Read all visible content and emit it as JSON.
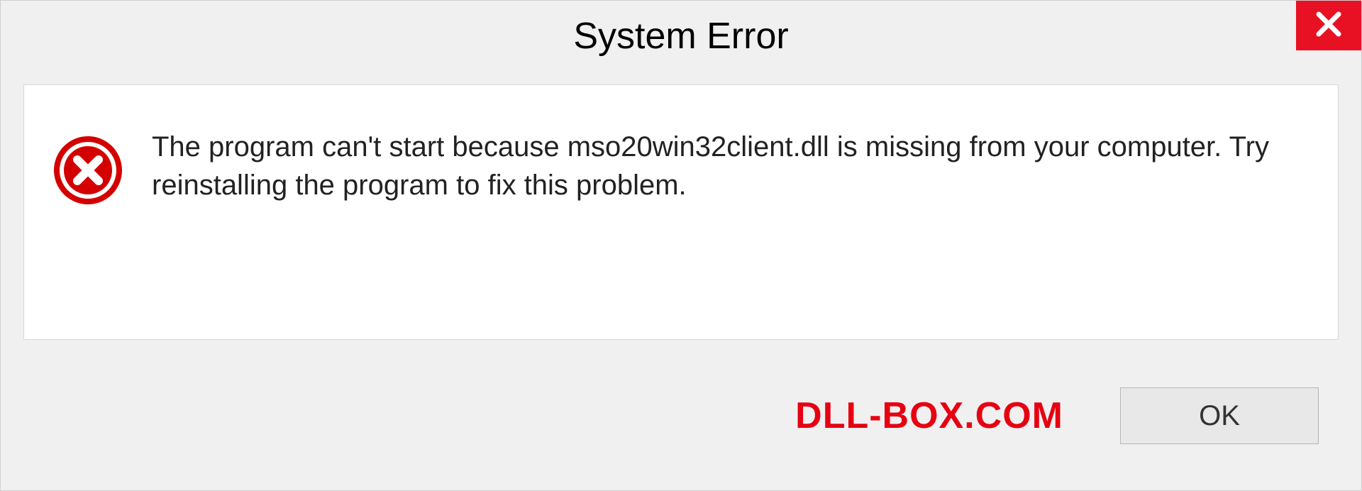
{
  "dialog": {
    "title": "System Error",
    "message": "The program can't start because mso20win32client.dll is missing from your computer. Try reinstalling the program to fix this problem.",
    "ok_label": "OK"
  },
  "watermark": "DLL-BOX.COM"
}
